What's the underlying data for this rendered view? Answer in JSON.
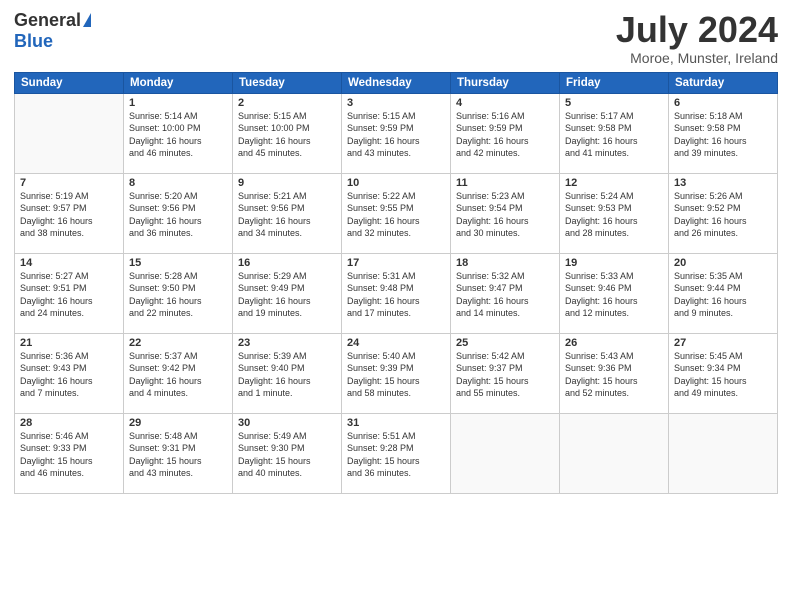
{
  "logo": {
    "general": "General",
    "blue": "Blue"
  },
  "title": "July 2024",
  "location": "Moroe, Munster, Ireland",
  "days_of_week": [
    "Sunday",
    "Monday",
    "Tuesday",
    "Wednesday",
    "Thursday",
    "Friday",
    "Saturday"
  ],
  "weeks": [
    [
      {
        "day": "",
        "info": ""
      },
      {
        "day": "1",
        "info": "Sunrise: 5:14 AM\nSunset: 10:00 PM\nDaylight: 16 hours\nand 46 minutes."
      },
      {
        "day": "2",
        "info": "Sunrise: 5:15 AM\nSunset: 10:00 PM\nDaylight: 16 hours\nand 45 minutes."
      },
      {
        "day": "3",
        "info": "Sunrise: 5:15 AM\nSunset: 9:59 PM\nDaylight: 16 hours\nand 43 minutes."
      },
      {
        "day": "4",
        "info": "Sunrise: 5:16 AM\nSunset: 9:59 PM\nDaylight: 16 hours\nand 42 minutes."
      },
      {
        "day": "5",
        "info": "Sunrise: 5:17 AM\nSunset: 9:58 PM\nDaylight: 16 hours\nand 41 minutes."
      },
      {
        "day": "6",
        "info": "Sunrise: 5:18 AM\nSunset: 9:58 PM\nDaylight: 16 hours\nand 39 minutes."
      }
    ],
    [
      {
        "day": "7",
        "info": "Sunrise: 5:19 AM\nSunset: 9:57 PM\nDaylight: 16 hours\nand 38 minutes."
      },
      {
        "day": "8",
        "info": "Sunrise: 5:20 AM\nSunset: 9:56 PM\nDaylight: 16 hours\nand 36 minutes."
      },
      {
        "day": "9",
        "info": "Sunrise: 5:21 AM\nSunset: 9:56 PM\nDaylight: 16 hours\nand 34 minutes."
      },
      {
        "day": "10",
        "info": "Sunrise: 5:22 AM\nSunset: 9:55 PM\nDaylight: 16 hours\nand 32 minutes."
      },
      {
        "day": "11",
        "info": "Sunrise: 5:23 AM\nSunset: 9:54 PM\nDaylight: 16 hours\nand 30 minutes."
      },
      {
        "day": "12",
        "info": "Sunrise: 5:24 AM\nSunset: 9:53 PM\nDaylight: 16 hours\nand 28 minutes."
      },
      {
        "day": "13",
        "info": "Sunrise: 5:26 AM\nSunset: 9:52 PM\nDaylight: 16 hours\nand 26 minutes."
      }
    ],
    [
      {
        "day": "14",
        "info": "Sunrise: 5:27 AM\nSunset: 9:51 PM\nDaylight: 16 hours\nand 24 minutes."
      },
      {
        "day": "15",
        "info": "Sunrise: 5:28 AM\nSunset: 9:50 PM\nDaylight: 16 hours\nand 22 minutes."
      },
      {
        "day": "16",
        "info": "Sunrise: 5:29 AM\nSunset: 9:49 PM\nDaylight: 16 hours\nand 19 minutes."
      },
      {
        "day": "17",
        "info": "Sunrise: 5:31 AM\nSunset: 9:48 PM\nDaylight: 16 hours\nand 17 minutes."
      },
      {
        "day": "18",
        "info": "Sunrise: 5:32 AM\nSunset: 9:47 PM\nDaylight: 16 hours\nand 14 minutes."
      },
      {
        "day": "19",
        "info": "Sunrise: 5:33 AM\nSunset: 9:46 PM\nDaylight: 16 hours\nand 12 minutes."
      },
      {
        "day": "20",
        "info": "Sunrise: 5:35 AM\nSunset: 9:44 PM\nDaylight: 16 hours\nand 9 minutes."
      }
    ],
    [
      {
        "day": "21",
        "info": "Sunrise: 5:36 AM\nSunset: 9:43 PM\nDaylight: 16 hours\nand 7 minutes."
      },
      {
        "day": "22",
        "info": "Sunrise: 5:37 AM\nSunset: 9:42 PM\nDaylight: 16 hours\nand 4 minutes."
      },
      {
        "day": "23",
        "info": "Sunrise: 5:39 AM\nSunset: 9:40 PM\nDaylight: 16 hours\nand 1 minute."
      },
      {
        "day": "24",
        "info": "Sunrise: 5:40 AM\nSunset: 9:39 PM\nDaylight: 15 hours\nand 58 minutes."
      },
      {
        "day": "25",
        "info": "Sunrise: 5:42 AM\nSunset: 9:37 PM\nDaylight: 15 hours\nand 55 minutes."
      },
      {
        "day": "26",
        "info": "Sunrise: 5:43 AM\nSunset: 9:36 PM\nDaylight: 15 hours\nand 52 minutes."
      },
      {
        "day": "27",
        "info": "Sunrise: 5:45 AM\nSunset: 9:34 PM\nDaylight: 15 hours\nand 49 minutes."
      }
    ],
    [
      {
        "day": "28",
        "info": "Sunrise: 5:46 AM\nSunset: 9:33 PM\nDaylight: 15 hours\nand 46 minutes."
      },
      {
        "day": "29",
        "info": "Sunrise: 5:48 AM\nSunset: 9:31 PM\nDaylight: 15 hours\nand 43 minutes."
      },
      {
        "day": "30",
        "info": "Sunrise: 5:49 AM\nSunset: 9:30 PM\nDaylight: 15 hours\nand 40 minutes."
      },
      {
        "day": "31",
        "info": "Sunrise: 5:51 AM\nSunset: 9:28 PM\nDaylight: 15 hours\nand 36 minutes."
      },
      {
        "day": "",
        "info": ""
      },
      {
        "day": "",
        "info": ""
      },
      {
        "day": "",
        "info": ""
      }
    ]
  ]
}
